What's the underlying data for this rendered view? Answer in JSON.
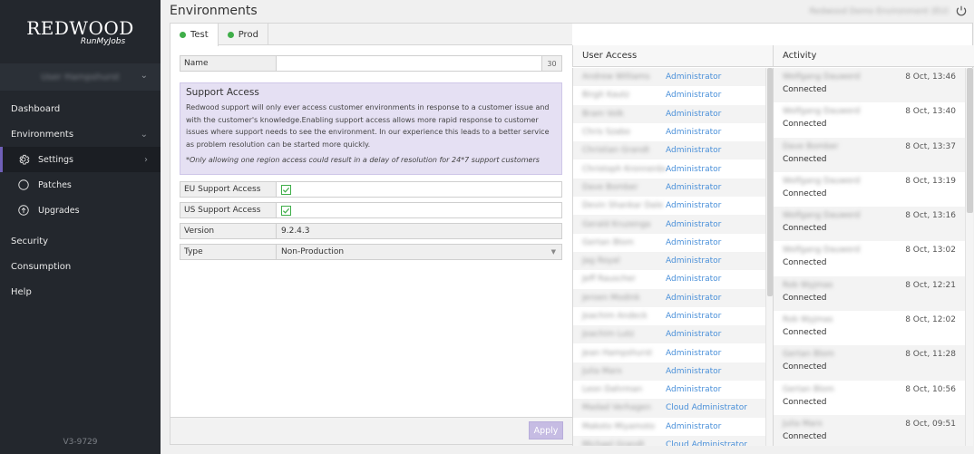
{
  "sidebar": {
    "logo_main": "REDWOOD",
    "logo_sub": "RunMyJobs",
    "user": "User Hampshurst",
    "nav": {
      "dashboard": "Dashboard",
      "environments": "Environments",
      "settings": "Settings",
      "patches": "Patches",
      "upgrades": "Upgrades",
      "security": "Security",
      "consumption": "Consumption",
      "help": "Help"
    },
    "version": "V3-9729"
  },
  "header": {
    "title": "Environments",
    "environment_name": "Redwood Demo Environment (EU)"
  },
  "tabs": [
    {
      "label": "Test",
      "status_color": "#3fae49"
    },
    {
      "label": "Prod",
      "status_color": "#3fae49"
    }
  ],
  "form": {
    "name_label": "Name",
    "name_value": "",
    "name_counter": "30",
    "support": {
      "title": "Support Access",
      "text": "Redwood support will only ever access customer environments in response to a customer issue and with the customer's knowledge.Enabling support access allows more rapid response to customer issues where support needs to see the environment. In our experience this leads to a better service as problem resolution can be started more quickly.",
      "note": "*Only allowing one region access could result in a delay of resolution for 24*7 support customers"
    },
    "eu_label": "EU Support Access",
    "eu_checked": true,
    "us_label": "US Support Access",
    "us_checked": true,
    "version_label": "Version",
    "version_value": "9.2.4.3",
    "type_label": "Type",
    "type_value": "Non-Production",
    "apply_label": "Apply"
  },
  "user_access": {
    "title": "User Access",
    "rows": [
      {
        "user": "Andrew Williams",
        "role": "Administrator"
      },
      {
        "user": "Birgit Kautz",
        "role": "Administrator"
      },
      {
        "user": "Bram Volk",
        "role": "Administrator"
      },
      {
        "user": "Chris Szabo",
        "role": "Administrator"
      },
      {
        "user": "Christian Grandt",
        "role": "Administrator"
      },
      {
        "user": "Christoph Kronnenberg",
        "role": "Administrator"
      },
      {
        "user": "Dave Bomber",
        "role": "Administrator"
      },
      {
        "user": "Devin Shankar Dale",
        "role": "Administrator"
      },
      {
        "user": "Gerald Kruzenga",
        "role": "Administrator"
      },
      {
        "user": "Gertan Blom",
        "role": "Administrator"
      },
      {
        "user": "Jag Royal",
        "role": "Administrator"
      },
      {
        "user": "Jeff Rauscher",
        "role": "Administrator"
      },
      {
        "user": "Jeroen Modink",
        "role": "Administrator"
      },
      {
        "user": "Joachim Andeck",
        "role": "Administrator"
      },
      {
        "user": "Joachim Lutz",
        "role": "Administrator"
      },
      {
        "user": "Jean Hampshurst",
        "role": "Administrator"
      },
      {
        "user": "Julia Marx",
        "role": "Administrator"
      },
      {
        "user": "Leon Dahrman",
        "role": "Administrator"
      },
      {
        "user": "Madad Verhagen",
        "role": "Cloud Administrator"
      },
      {
        "user": "Makoto Miyamoto",
        "role": "Administrator"
      },
      {
        "user": "Michael Grandt",
        "role": "Cloud Administrator"
      }
    ]
  },
  "activity": {
    "title": "Activity",
    "rows": [
      {
        "user": "Wolfgang Dauwerd",
        "time": "8 Oct, 13:46",
        "status": "Connected"
      },
      {
        "user": "Wolfgang Dauwerd",
        "time": "8 Oct, 13:40",
        "status": "Connected"
      },
      {
        "user": "Dave Bomber",
        "time": "8 Oct, 13:37",
        "status": "Connected"
      },
      {
        "user": "Wolfgang Dauwerd",
        "time": "8 Oct, 13:19",
        "status": "Connected"
      },
      {
        "user": "Wolfgang Dauwerd",
        "time": "8 Oct, 13:16",
        "status": "Connected"
      },
      {
        "user": "Wolfgang Dauwerd",
        "time": "8 Oct, 13:02",
        "status": "Connected"
      },
      {
        "user": "Rob Wyjmas",
        "time": "8 Oct, 12:21",
        "status": "Connected"
      },
      {
        "user": "Rob Wyjmas",
        "time": "8 Oct, 12:02",
        "status": "Connected"
      },
      {
        "user": "Gertan Blom",
        "time": "8 Oct, 11:28",
        "status": "Connected"
      },
      {
        "user": "Gertan Blom",
        "time": "8 Oct, 10:56",
        "status": "Connected"
      },
      {
        "user": "Julia Marx",
        "time": "8 Oct, 09:51",
        "status": "Connected"
      }
    ]
  },
  "colors": {
    "sidebar_bg": "#23272d",
    "accent": "#6f5fb7",
    "link": "#4a90d9",
    "status_green": "#3fae49",
    "support_bg": "#e5e0f3"
  },
  "icons": [
    "chevron-down-icon",
    "chevron-right-icon",
    "gear-icon",
    "circle-icon",
    "upload-icon",
    "power-icon",
    "checkmark-icon",
    "dropdown-arrow-icon"
  ]
}
